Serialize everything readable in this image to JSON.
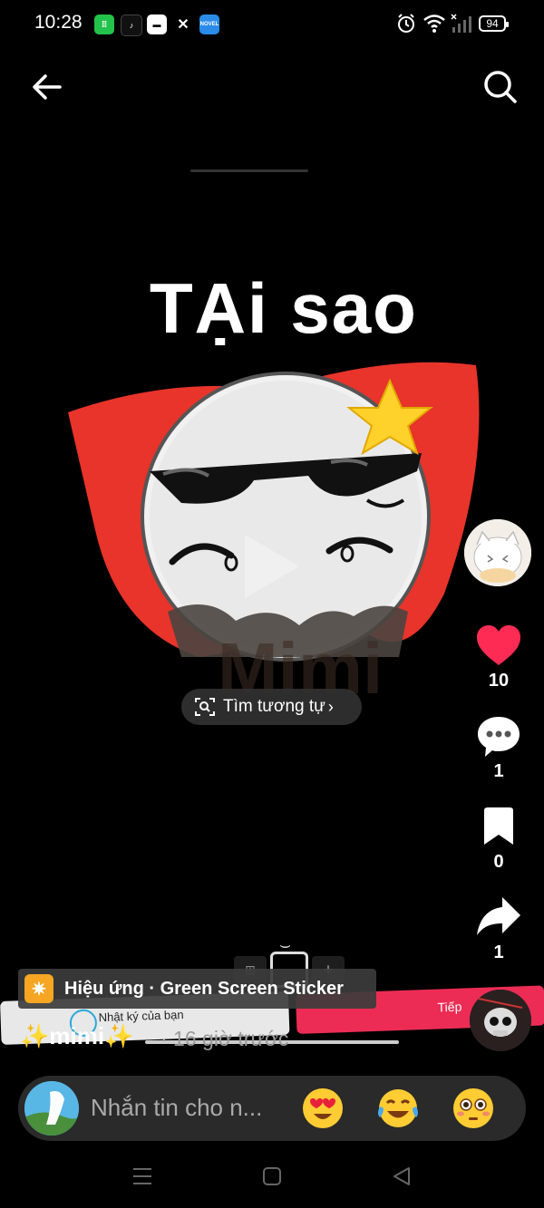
{
  "status_bar": {
    "time": "10:28",
    "battery": "94"
  },
  "header": {
    "back_icon": "arrow-left-icon",
    "search_icon": "search-icon"
  },
  "video": {
    "overlay_text": "TẠi sao",
    "find_similar_label": "Tìm tương tự",
    "background_app_labels": {
      "diary": "Nhật ký của bạn",
      "next": "Tiếp"
    }
  },
  "rail": {
    "like_count": "10",
    "comment_count": "1",
    "bookmark_count": "0",
    "share_count": "1"
  },
  "effect": {
    "label": "Hiệu ứng · Green Screen Sticker"
  },
  "author": {
    "username": "✨mimi✨",
    "time_ago": "· 16 giờ trước"
  },
  "message_bar": {
    "placeholder": "Nhắn tin cho n...",
    "emojis": [
      "heart-eyes-emoji",
      "tears-of-joy-emoji",
      "flushed-emoji"
    ]
  },
  "colors": {
    "like": "#fe2c55",
    "red_shape": "#e8342a",
    "star": "#ffd12a"
  }
}
